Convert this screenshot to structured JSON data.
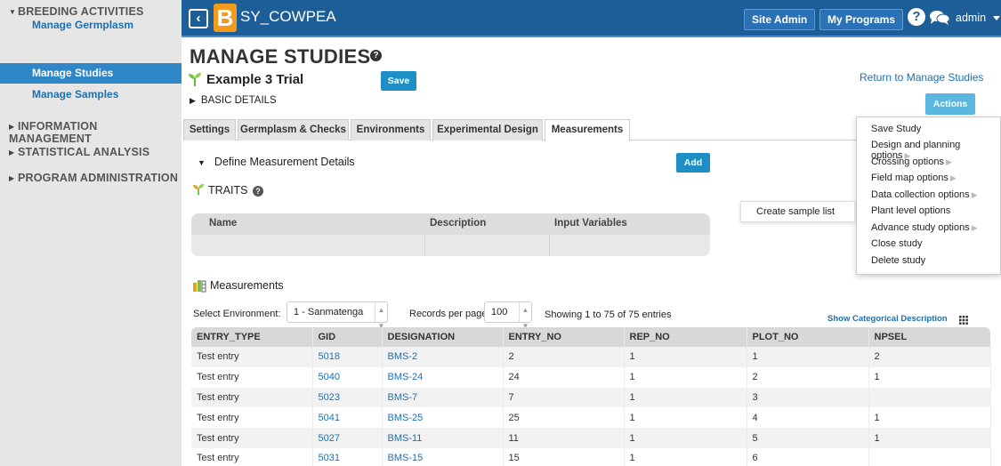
{
  "sidebar": {
    "sections": [
      {
        "label": "BREEDING ACTIVITIES",
        "expanded": true
      },
      {
        "label": "INFORMATION MANAGEMENT",
        "expanded": false
      },
      {
        "label": "STATISTICAL ANALYSIS",
        "expanded": false
      },
      {
        "label": "PROGRAM ADMINISTRATION",
        "expanded": false
      }
    ],
    "items": [
      {
        "label": "Manage Germplasm",
        "active": false
      },
      {
        "label": "Manage Studies",
        "active": true
      },
      {
        "label": "Manage Samples",
        "active": false
      }
    ]
  },
  "topbar": {
    "back_icon": "chevron-left-icon",
    "logo_letter": "B",
    "crop_name": "SY_COWPEA",
    "site_admin": "Site Admin",
    "my_programs": "My Programs",
    "help": "?",
    "user": "admin"
  },
  "page": {
    "title": "MANAGE STUDIES",
    "help": "?",
    "study_name": "Example 3 Trial",
    "save_label": "Save",
    "basic_details": "BASIC DETAILS",
    "return_link": "Return to Manage Studies",
    "actions_label": "Actions"
  },
  "tabs": [
    "Settings",
    "Germplasm & Checks",
    "Environments",
    "Experimental Design",
    "Measurements"
  ],
  "active_tab": "Measurements",
  "define": {
    "label": "Define Measurement Details",
    "add_label": "Add",
    "traits_label": "TRAITS",
    "traits_columns": [
      "Name",
      "Description",
      "Input Variables"
    ]
  },
  "actions_menu": [
    {
      "label": "Save Study",
      "sub": false
    },
    {
      "label": "Design and planning options",
      "sub": true
    },
    {
      "label": "Crossing options",
      "sub": true
    },
    {
      "label": "Field map options",
      "sub": true
    },
    {
      "label": "Data collection options",
      "sub": true
    },
    {
      "label": "Plant level options",
      "sub": false
    },
    {
      "label": "Advance study options",
      "sub": true
    },
    {
      "label": "Close study",
      "sub": false
    },
    {
      "label": "Delete study",
      "sub": false
    }
  ],
  "submenu": {
    "label": "Create sample list"
  },
  "measurements": {
    "title": "Measurements",
    "env_label": "Select Environment:",
    "env_value": "1 - Sanmatenga",
    "rpp_label": "Records per page:",
    "rpp_value": "100",
    "showing": "Showing 1 to 75 of 75 entries",
    "show_categorical": "Show Categorical Description",
    "columns": [
      "ENTRY_TYPE",
      "GID",
      "DESIGNATION",
      "ENTRY_NO",
      "REP_NO",
      "PLOT_NO",
      "NPSEL"
    ],
    "rows": [
      [
        "Test entry",
        "5018",
        "BMS-2",
        "2",
        "1",
        "1",
        "2"
      ],
      [
        "Test entry",
        "5040",
        "BMS-24",
        "24",
        "1",
        "2",
        "1"
      ],
      [
        "Test entry",
        "5023",
        "BMS-7",
        "7",
        "1",
        "3",
        ""
      ],
      [
        "Test entry",
        "5041",
        "BMS-25",
        "25",
        "1",
        "4",
        "1"
      ],
      [
        "Test entry",
        "5027",
        "BMS-11",
        "11",
        "1",
        "5",
        "1"
      ],
      [
        "Test entry",
        "5031",
        "BMS-15",
        "15",
        "1",
        "6",
        ""
      ]
    ]
  },
  "colors": {
    "topbar": "#1d5e98",
    "sidebar_active": "#2f87c8",
    "button": "#1e8fc4",
    "link": "#1f6fae",
    "logo": "#f39b1a"
  }
}
